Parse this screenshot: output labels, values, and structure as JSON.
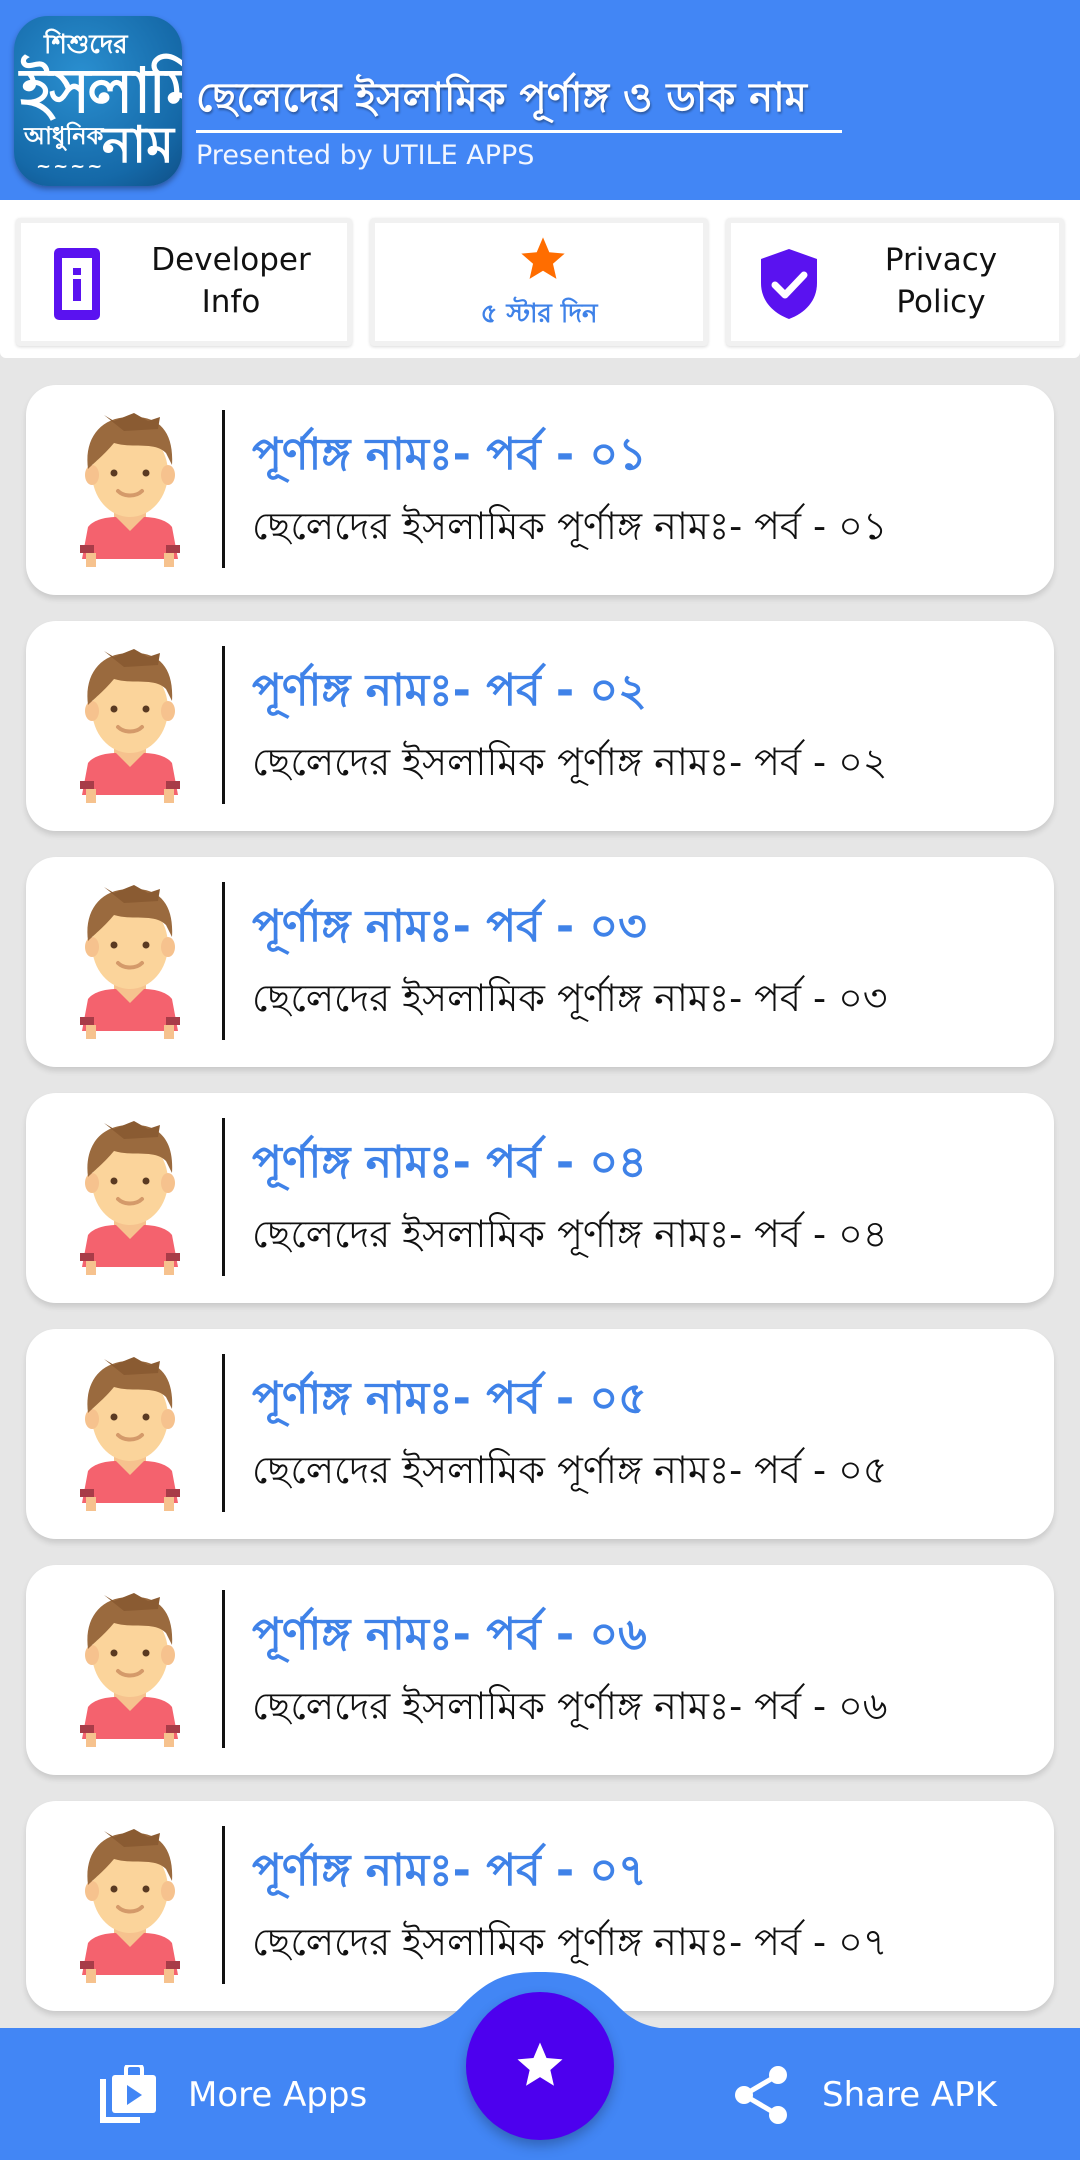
{
  "header": {
    "logo": {
      "line1": "শিশুদের",
      "line2": "ইসলামি",
      "line3": "আধুনিক",
      "line4": "নাম",
      "line5": "~~~~"
    },
    "title": "ছেলেদের ইসলামিক পূর্ণাঙ্গ ও ডাক নাম",
    "subtitle": "Presented by UTILE APPS"
  },
  "toolbar": {
    "developer_info": {
      "label": "Developer Info",
      "icon": "info-phone-icon"
    },
    "rate": {
      "label": "৫ স্টার দিন",
      "icon": "star-icon"
    },
    "privacy_policy": {
      "label": "Privacy Policy",
      "icon": "shield-check-icon"
    }
  },
  "items": [
    {
      "title": "পূর্ণাঙ্গ নামঃ- পর্ব - ০১",
      "subtitle": "ছেলেদের ইসলামিক পূর্ণাঙ্গ নামঃ- পর্ব - ০১"
    },
    {
      "title": "পূর্ণাঙ্গ নামঃ- পর্ব - ০২",
      "subtitle": "ছেলেদের ইসলামিক পূর্ণাঙ্গ নামঃ- পর্ব - ০২"
    },
    {
      "title": "পূর্ণাঙ্গ নামঃ- পর্ব - ০৩",
      "subtitle": "ছেলেদের ইসলামিক পূর্ণাঙ্গ নামঃ- পর্ব - ০৩"
    },
    {
      "title": "পূর্ণাঙ্গ নামঃ- পর্ব - ০৪",
      "subtitle": "ছেলেদের ইসলামিক পূর্ণাঙ্গ নামঃ- পর্ব - ০৪"
    },
    {
      "title": "পূর্ণাঙ্গ নামঃ- পর্ব - ০৫",
      "subtitle": "ছেলেদের ইসলামিক পূর্ণাঙ্গ নামঃ- পর্ব - ০৫"
    },
    {
      "title": "পূর্ণাঙ্গ নামঃ- পর্ব - ০৬",
      "subtitle": "ছেলেদের ইসলামিক পূর্ণাঙ্গ নামঃ- পর্ব - ০৬"
    },
    {
      "title": "পূর্ণাঙ্গ নামঃ- পর্ব - ০৭",
      "subtitle": "ছেলেদের ইসলামিক পূর্ণাঙ্গ নামঃ- পর্ব - ০৭"
    }
  ],
  "bottom_nav": {
    "more_apps": "More Apps",
    "share_apk": "Share APK",
    "fab_icon": "star-icon"
  },
  "colors": {
    "primary": "#4286f5",
    "accent": "#4d00ee",
    "title_blue": "#3f82e8",
    "star_orange": "#ff6d00",
    "icon_purple": "#5a12f0"
  }
}
